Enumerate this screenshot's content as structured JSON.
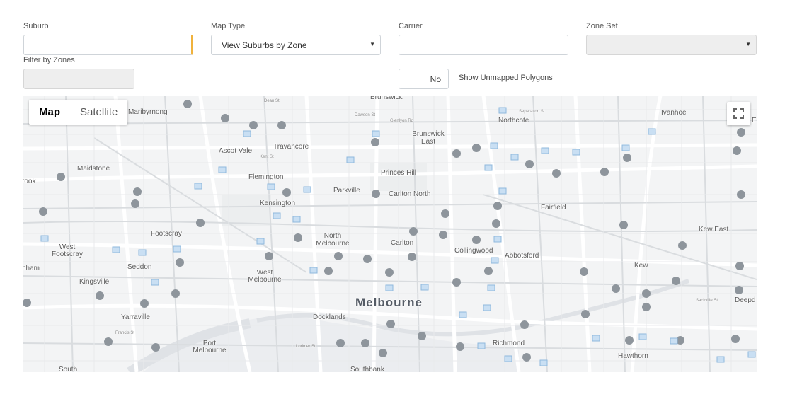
{
  "filters": {
    "suburb_label": "Suburb",
    "suburb_value": "",
    "map_type_label": "Map Type",
    "map_type_value": "View Suburbs by Zone",
    "carrier_label": "Carrier",
    "carrier_value": "",
    "zone_set_label": "Zone Set",
    "zone_set_value": "",
    "filter_zones_label": "Filter by Zones",
    "filter_zones_value": "",
    "unmapped_toggle_value": "No",
    "unmapped_label": "Show Unmapped Polygons"
  },
  "map": {
    "type_map": "Map",
    "type_satellite": "Satellite",
    "places": {
      "brunswick": "Brunswick",
      "maribyrnong": "Maribyrnong",
      "northcote": "Northcote",
      "ivanhoe": "Ivanhoe",
      "brunswick_east": "Brunswick East",
      "ascot_vale": "Ascot Vale",
      "travancore": "Travancore",
      "maidstone": "Maidstone",
      "princes_hill": "Princes Hill",
      "flemington": "Flemington",
      "parkville": "Parkville",
      "carlton_north": "Carlton North",
      "kensington": "Kensington",
      "fairfield": "Fairfield",
      "footscray": "Footscray",
      "north_melbourne": "North Melbourne",
      "carlton": "Carlton",
      "kew_east": "Kew East",
      "west_footscray": "West Footscray",
      "collingwood": "Collingwood",
      "abbotsford": "Abbotsford",
      "seddon": "Seddon",
      "kew": "Kew",
      "west_melbourne": "West Melbourne",
      "kingsville": "Kingsville",
      "melbourne": "Melbourne",
      "yarraville": "Yarraville",
      "docklands": "Docklands",
      "richmond": "Richmond",
      "port_melbourne": "Port Melbourne",
      "hawthorn": "Hawthorn",
      "southbank": "Southbank",
      "south": "South",
      "rook": "rook",
      "nham": "nham",
      "deepd": "Deepd",
      "e": "E"
    },
    "streets": {
      "dean_st": "Dean St",
      "dawson_st": "Dawson St",
      "glenlyon_rd": "Glenlyon Rd",
      "separation_st": "Separation St",
      "kent_st": "Kent St",
      "lorimer_st": "Lorimer St",
      "sackville_st": "Sackville St",
      "francis_st": "Francis St"
    }
  }
}
